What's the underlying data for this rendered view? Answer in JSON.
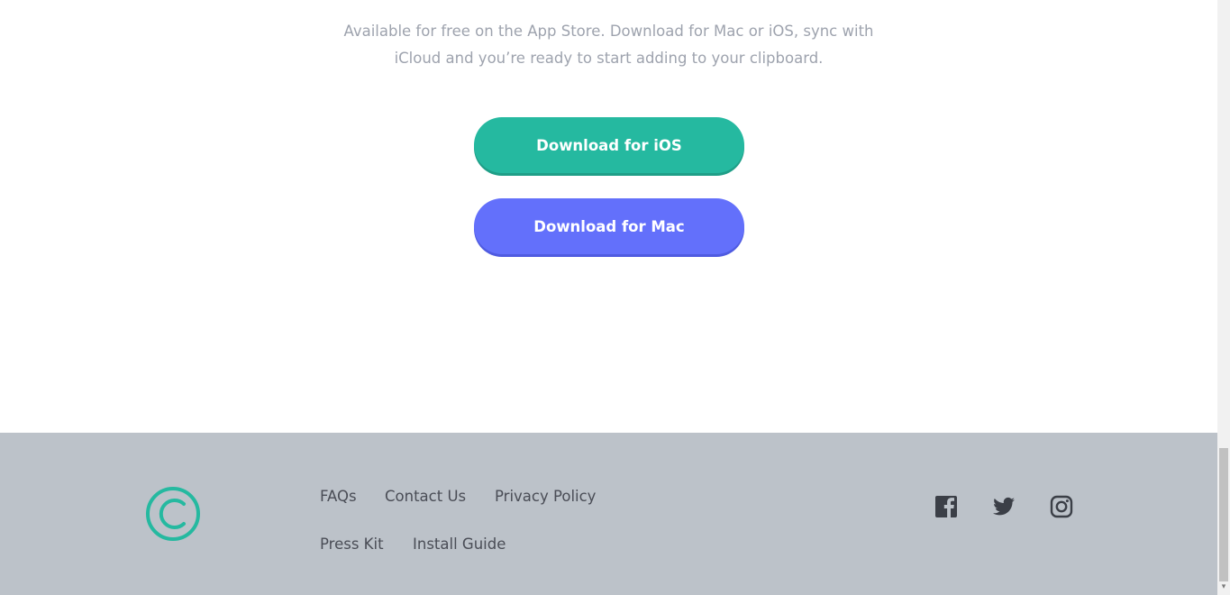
{
  "intro": {
    "line1": "Available for free on the App Store. Download for Mac or iOS, sync with",
    "line2": "iCloud and you’re ready to start adding to your clipboard."
  },
  "buttons": {
    "ios_label": "Download for iOS",
    "mac_label": "Download for Mac"
  },
  "footer": {
    "links": [
      "FAQs",
      "Contact Us",
      "Privacy Policy",
      "Press Kit",
      "Install Guide"
    ],
    "social_icons": [
      "facebook-icon",
      "twitter-icon",
      "instagram-icon"
    ]
  },
  "colors": {
    "accent_green": "#25b9a0",
    "accent_purple": "#6370fb",
    "footer_bg": "#bcc2c9",
    "text_muted": "#9ea3ae"
  }
}
